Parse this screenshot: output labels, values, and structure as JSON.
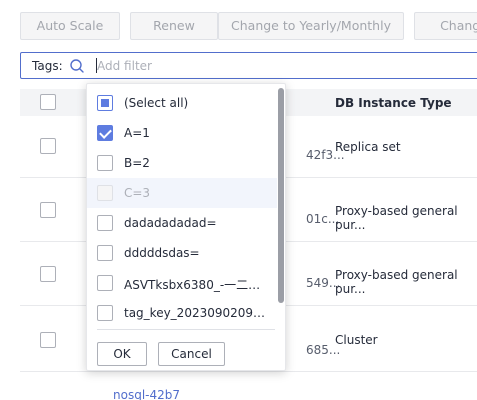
{
  "toolbar": {
    "buttons": [
      "Auto Scale",
      "Renew",
      "Change to Yearly/Monthly",
      "Change"
    ]
  },
  "search": {
    "label": "Tags:",
    "placeholder": "Add filter",
    "icon": "search-icon"
  },
  "table": {
    "header_type": "DB Instance Type",
    "rows": [
      {
        "id_fragment": "42f3...",
        "type": "Replica set"
      },
      {
        "id_fragment": "01c...",
        "type": "Proxy-based general pur..."
      },
      {
        "id_fragment": "549...",
        "type": "Proxy-based general pur..."
      },
      {
        "id_fragment": "685...",
        "type": "Cluster"
      }
    ],
    "next_row_link": "nosql-42b7"
  },
  "dropdown": {
    "options": [
      {
        "label": "(Select all)",
        "state": "partial"
      },
      {
        "label": "A=1",
        "state": "checked"
      },
      {
        "label": "B=2",
        "state": "unchecked"
      },
      {
        "label": "C=3",
        "state": "disabled"
      },
      {
        "label": "dadadadadad=",
        "state": "unchecked"
      },
      {
        "label": "dddddsdas=",
        "state": "unchecked"
      },
      {
        "label": "ASVTksbx6380_-一二三=...",
        "state": "unchecked"
      },
      {
        "label": "tag_key_2023090209212...",
        "state": "unchecked"
      }
    ],
    "ok_label": "OK",
    "cancel_label": "Cancel"
  },
  "colors": {
    "accent": "#5e7ce0",
    "link": "#526ecc"
  }
}
